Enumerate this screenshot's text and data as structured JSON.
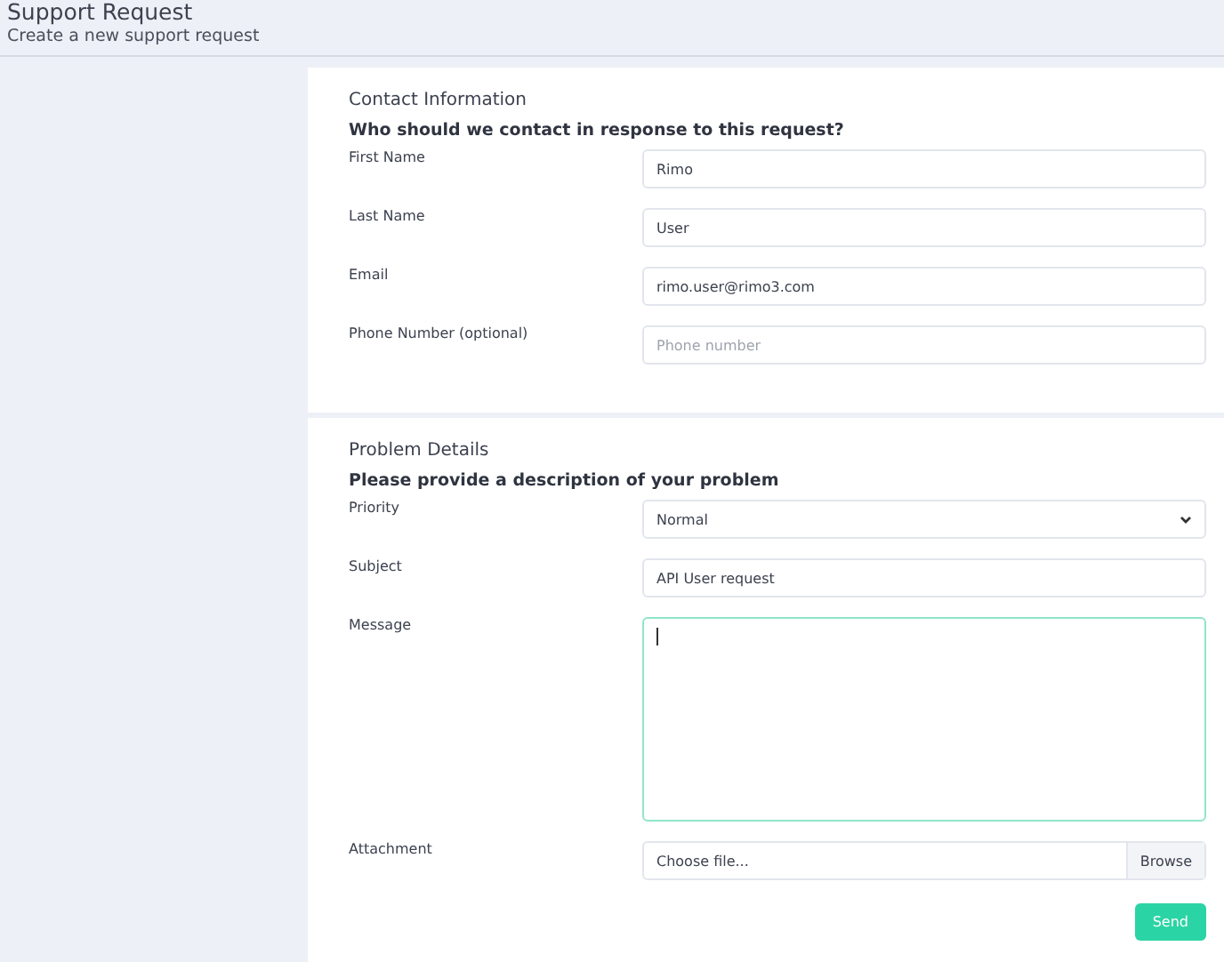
{
  "header": {
    "title": "Support Request",
    "subtitle": "Create a new support request"
  },
  "sections": [
    {
      "title": "Contact Information",
      "prompt": "Who should we contact in response to this request?",
      "fields": [
        {
          "kind": "text",
          "label": "First Name",
          "value": "Rimo",
          "focused": false
        },
        {
          "kind": "text",
          "label": "Last Name",
          "value": "User",
          "focused": false
        },
        {
          "kind": "text",
          "label": "Email",
          "value": "rimo.user@rimo3.com",
          "focused": false
        },
        {
          "kind": "text",
          "label": "Phone Number (optional)",
          "placeholder": "Phone number",
          "focused": false
        }
      ]
    },
    {
      "title": "Problem Details",
      "prompt": "Please provide a description of your problem",
      "fields": [
        {
          "kind": "select",
          "label": "Priority",
          "value": "Normal",
          "focused": false
        },
        {
          "kind": "text",
          "label": "Subject",
          "value": "API User request",
          "focused": false
        },
        {
          "kind": "textarea",
          "label": "Message",
          "focused": true
        },
        {
          "kind": "file",
          "label": "Attachment",
          "placeholder": "Choose file...",
          "button": "Browse",
          "focused": false
        }
      ],
      "submit": "Send"
    }
  ]
}
